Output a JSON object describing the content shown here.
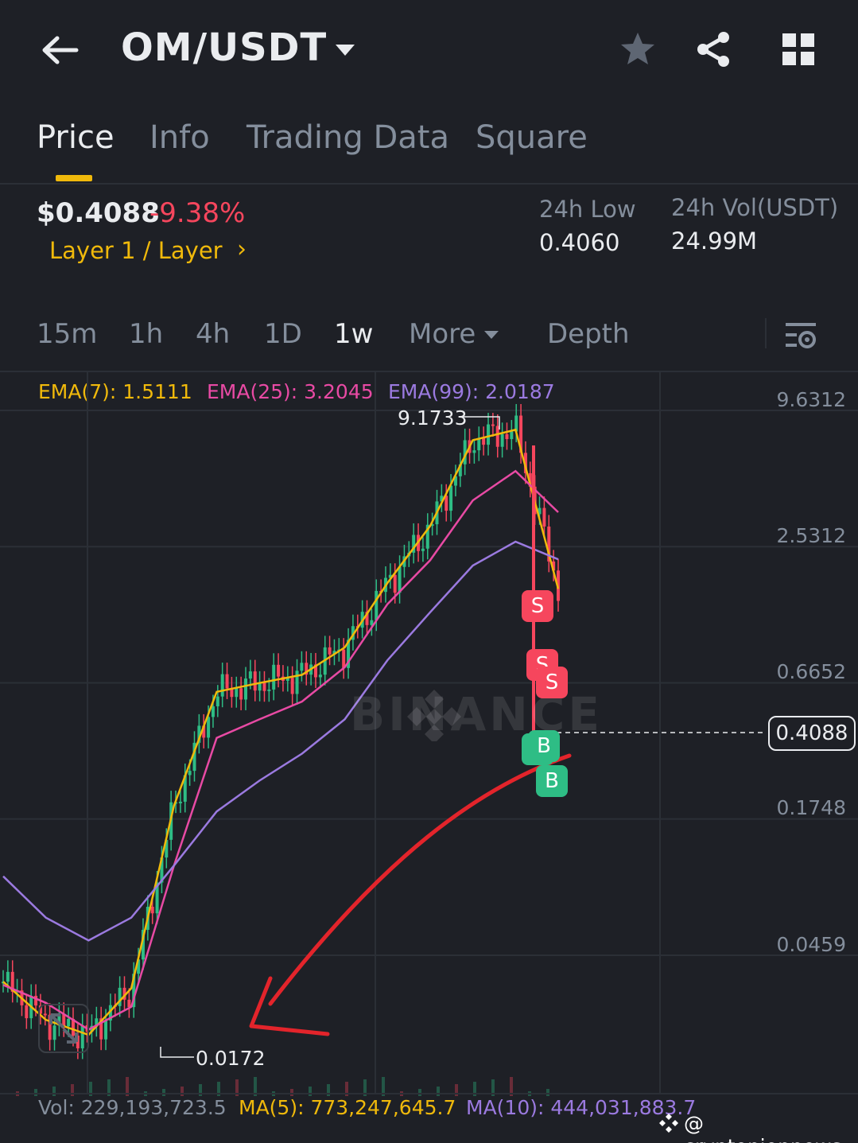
{
  "header": {
    "pair": "OM/USDT"
  },
  "tabs": [
    {
      "label": "Price",
      "active": true
    },
    {
      "label": "Info",
      "active": false
    },
    {
      "label": "Trading Data",
      "active": false
    },
    {
      "label": "Square",
      "active": false
    }
  ],
  "ticker": {
    "price": "$0.4088",
    "change": "-9.38%",
    "category": "Layer 1 / Layer",
    "category_arrow": "›",
    "low_label": "24h Low",
    "low_value": "0.4060",
    "vol_label": "24h Vol(USDT)",
    "vol_value": "24.99M"
  },
  "intervals": [
    {
      "label": "15m",
      "active": false
    },
    {
      "label": "1h",
      "active": false
    },
    {
      "label": "4h",
      "active": false
    },
    {
      "label": "1D",
      "active": false
    },
    {
      "label": "1w",
      "active": true
    },
    {
      "label": "More",
      "active": false
    },
    {
      "label": "Depth",
      "active": false
    }
  ],
  "indicators": {
    "ema7": "EMA(7): 1.5111",
    "ema25": "EMA(25): 3.2045",
    "ema99": "EMA(99): 2.0187"
  },
  "colors": {
    "ema7": "#f0b90b",
    "ema25": "#e84aa4",
    "ema99": "#9b7ae0",
    "up": "#2ebd85",
    "down": "#f6465d",
    "annotation": "#e3242b"
  },
  "chart_data": {
    "type": "candlestick",
    "y_scale": "log",
    "y_ticks": [
      "9.6312",
      "2.5312",
      "0.6652",
      "0.1748",
      "0.0459"
    ],
    "current_price": "0.4088",
    "high_label": "9.1733",
    "low_label": "0.0172",
    "watermark": "BINANCE",
    "trade_markers": [
      {
        "side": "sell",
        "label": "S"
      },
      {
        "side": "sell",
        "label": "S"
      },
      {
        "side": "sell",
        "label": "S"
      },
      {
        "side": "buy",
        "label": "B"
      },
      {
        "side": "buy",
        "label": "B"
      },
      {
        "side": "buy",
        "label": "B"
      }
    ],
    "series": [
      {
        "name": "EMA(7)",
        "values": [
          0.032,
          0.022,
          0.019,
          0.03,
          0.18,
          0.55,
          0.6,
          0.65,
          0.85,
          1.6,
          2.8,
          6.5,
          7.2,
          1.5111
        ]
      },
      {
        "name": "EMA(25)",
        "values": [
          0.031,
          0.026,
          0.02,
          0.025,
          0.1,
          0.35,
          0.42,
          0.5,
          0.7,
          1.3,
          2.0,
          3.6,
          4.8,
          3.2045
        ]
      },
      {
        "name": "EMA(99)",
        "values": [
          0.09,
          0.06,
          0.048,
          0.06,
          0.1,
          0.17,
          0.23,
          0.3,
          0.42,
          0.75,
          1.2,
          1.9,
          2.4,
          2.0187
        ]
      }
    ]
  },
  "volume": {
    "vol": "Vol: 229,193,723.5",
    "ma5": "MA(5): 773,247,645.7",
    "ma10": "MA(10): 444,031,883.7"
  },
  "credit": "@ cryptonionnews"
}
